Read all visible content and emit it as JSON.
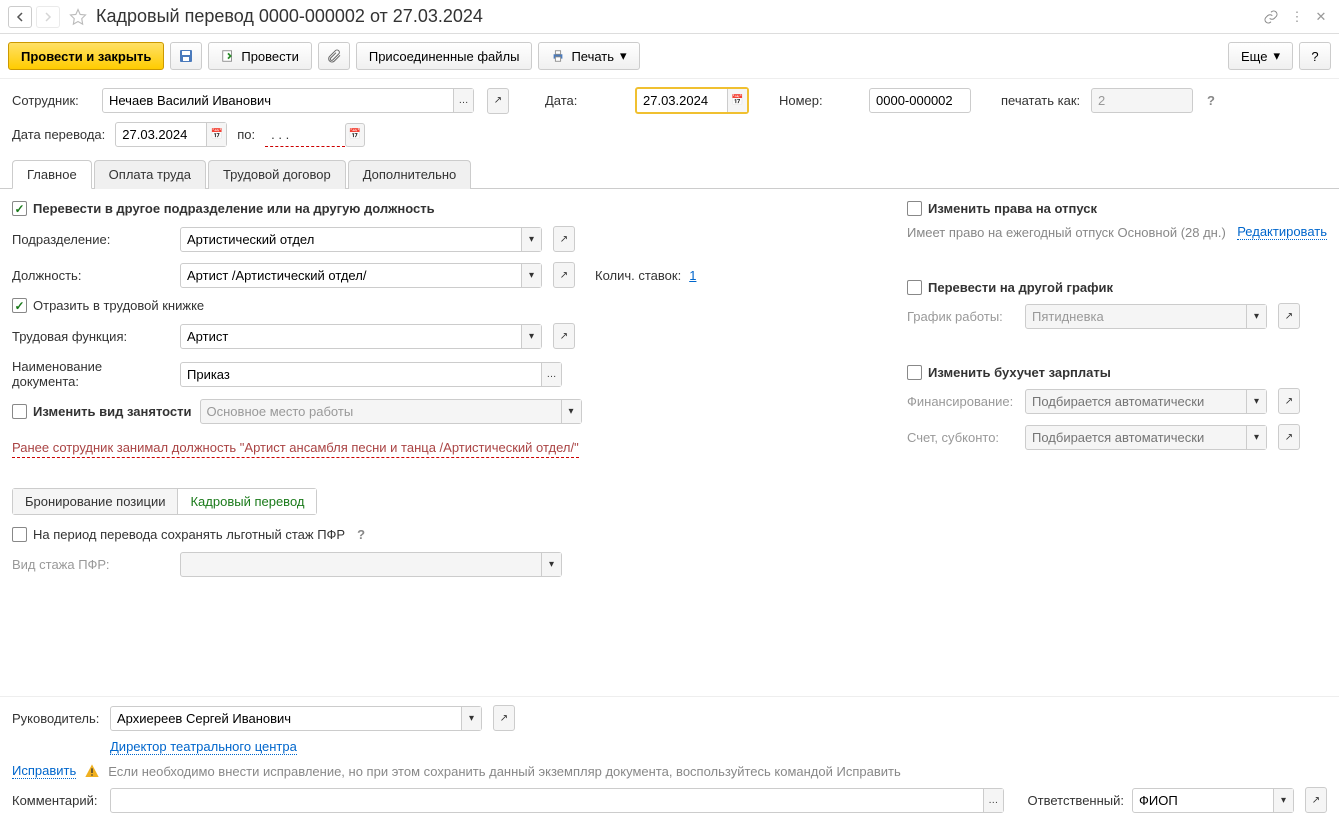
{
  "title": "Кадровый перевод 0000-000002 от 27.03.2024",
  "toolbar": {
    "conduct_close": "Провести и закрыть",
    "conduct": "Провести",
    "attached_files": "Присоединенные файлы",
    "print": "Печать",
    "more": "Еще"
  },
  "header": {
    "employee_label": "Сотрудник:",
    "employee": "Нечаев Василий Иванович",
    "date_label": "Дата:",
    "date": "27.03.2024",
    "number_label": "Номер:",
    "number": "0000-000002",
    "print_as_label": "печатать как:",
    "print_as": "2",
    "transfer_date_label": "Дата перевода:",
    "transfer_date": "27.03.2024",
    "to_label": "по:",
    "to_value": ". . ."
  },
  "tabs": [
    "Главное",
    "Оплата труда",
    "Трудовой договор",
    "Дополнительно"
  ],
  "main": {
    "transfer_checkbox": "Перевести в другое подразделение или на другую должность",
    "dept_label": "Подразделение:",
    "dept": "Артистический отдел",
    "position_label": "Должность:",
    "position": "Артист /Артистический отдел/",
    "rates_label": "Колич. ставок:",
    "rates": "1",
    "workbook_checkbox": "Отразить в трудовой книжке",
    "function_label": "Трудовая функция:",
    "function": "Артист",
    "docname_label": "Наименование документа:",
    "docname": "Приказ",
    "employment_type_checkbox": "Изменить вид занятости",
    "employment_type": "Основное место работы",
    "prev_note": "Ранее сотрудник занимал должность \"Артист ансамбля песни и танца /Артистический отдел/\"",
    "subtabs": [
      "Бронирование позиции",
      "Кадровый перевод"
    ],
    "pfr_checkbox": "На период перевода сохранять льготный стаж ПФР",
    "pfr_type_label": "Вид стажа ПФР:"
  },
  "right": {
    "vacation_checkbox": "Изменить права на отпуск",
    "vacation_text": "Имеет право на ежегодный отпуск Основной (28 дн.)",
    "edit_link": "Редактировать",
    "schedule_checkbox": "Перевести на другой график",
    "schedule_label": "График работы:",
    "schedule": "Пятидневка",
    "acc_checkbox": "Изменить бухучет зарплаты",
    "financing_label": "Финансирование:",
    "financing_ph": "Подбирается автоматически",
    "account_label": "Счет, субконто:",
    "account_ph": "Подбирается автоматически"
  },
  "footer": {
    "manager_label": "Руководитель:",
    "manager": "Архиереев Сергей Иванович",
    "manager_pos": "Директор театрального центра",
    "fix_link": "Исправить",
    "fix_text": "Если необходимо внести исправление, но при этом сохранить данный экземпляр документа, воспользуйтесь командой Исправить",
    "comment_label": "Комментарий:",
    "responsible_label": "Ответственный:",
    "responsible": "ФИОП"
  }
}
